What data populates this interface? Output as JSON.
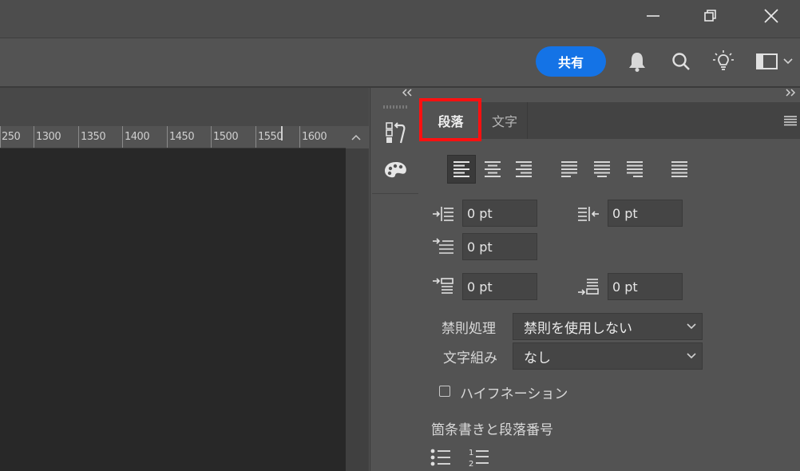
{
  "window": {
    "minimize_icon": "minimize-icon",
    "restore_icon": "restore-icon",
    "close_icon": "close-icon"
  },
  "topbar": {
    "share_label": "共有",
    "icons": [
      "bell-icon",
      "search-icon",
      "lightbulb-icon",
      "workspace-icon",
      "chevron-down-icon"
    ]
  },
  "ruler": {
    "labels": [
      "250",
      "1300",
      "1350",
      "1400",
      "1450",
      "1500",
      "1550",
      "1600"
    ]
  },
  "panel": {
    "tabs": [
      {
        "label": "段落",
        "active": true
      },
      {
        "label": "文字",
        "active": false
      }
    ],
    "alignment_icons": [
      "align-left-icon",
      "align-center-icon",
      "align-right-icon",
      "justify-last-left-icon",
      "justify-last-center-icon",
      "justify-last-right-icon",
      "justify-all-icon"
    ],
    "left_indent": "0 pt",
    "right_indent": "0 pt",
    "first_line_indent": "0 pt",
    "space_before": "0 pt",
    "space_after": "0 pt",
    "kinsoku_label": "禁則処理",
    "kinsoku_value": "禁則を使用しない",
    "mojikumi_label": "文字組み",
    "mojikumi_value": "なし",
    "hyphenation_label": "ハイフネーション",
    "hyphenation_checked": false,
    "bullets_label": "箇条書きと段落番号"
  },
  "colors": {
    "accent": "#1473e6",
    "highlight": "#ff1010",
    "panel_bg": "#535353",
    "canvas_bg": "#282828"
  }
}
